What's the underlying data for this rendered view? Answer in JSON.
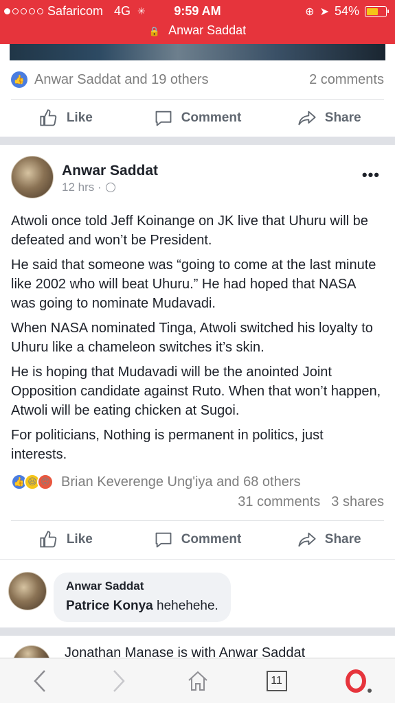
{
  "status_bar": {
    "carrier": "Safaricom",
    "network": "4G",
    "time": "9:59 AM",
    "battery": "54%"
  },
  "url_bar": {
    "title": "Anwar Saddat"
  },
  "prev_post": {
    "reactions_text": "Anwar Saddat and 19 others",
    "comments": "2 comments"
  },
  "actions": {
    "like": "Like",
    "comment": "Comment",
    "share": "Share"
  },
  "post": {
    "author": "Anwar Saddat",
    "time": "12 hrs ·",
    "paragraphs": [
      "Atwoli once told Jeff Koinange on JK live that Uhuru will be defeated and won’t be President.",
      "He said that someone was “going to come at the last minute like 2002 who will beat Uhuru.” He had hoped that NASA was going to nominate Mudavadi.",
      "When NASA nominated Tinga, Atwoli switched his loyalty to Uhuru like a chameleon switches it’s skin.",
      "He is hoping that Mudavadi will be the anointed Joint Opposition candidate against Ruto. When that won’t happen, Atwoli will be eating chicken at Sugoi.",
      "For politicians, Nothing is permanent in politics, just interests."
    ],
    "reactions_text": "Brian Keverenge Ung'iya and 68 others",
    "comments": "31 comments",
    "shares": "3 shares"
  },
  "comment": {
    "author": "Anwar Saddat",
    "mention": "Patrice Konya",
    "text": "hehehehe."
  },
  "next_post": {
    "header": "Jonathan Manase is with Anwar Saddat"
  },
  "bottom_bar": {
    "tabs_count": "11"
  },
  "colors": {
    "brand": "#e6343c",
    "like_blue": "#4a7de0"
  }
}
